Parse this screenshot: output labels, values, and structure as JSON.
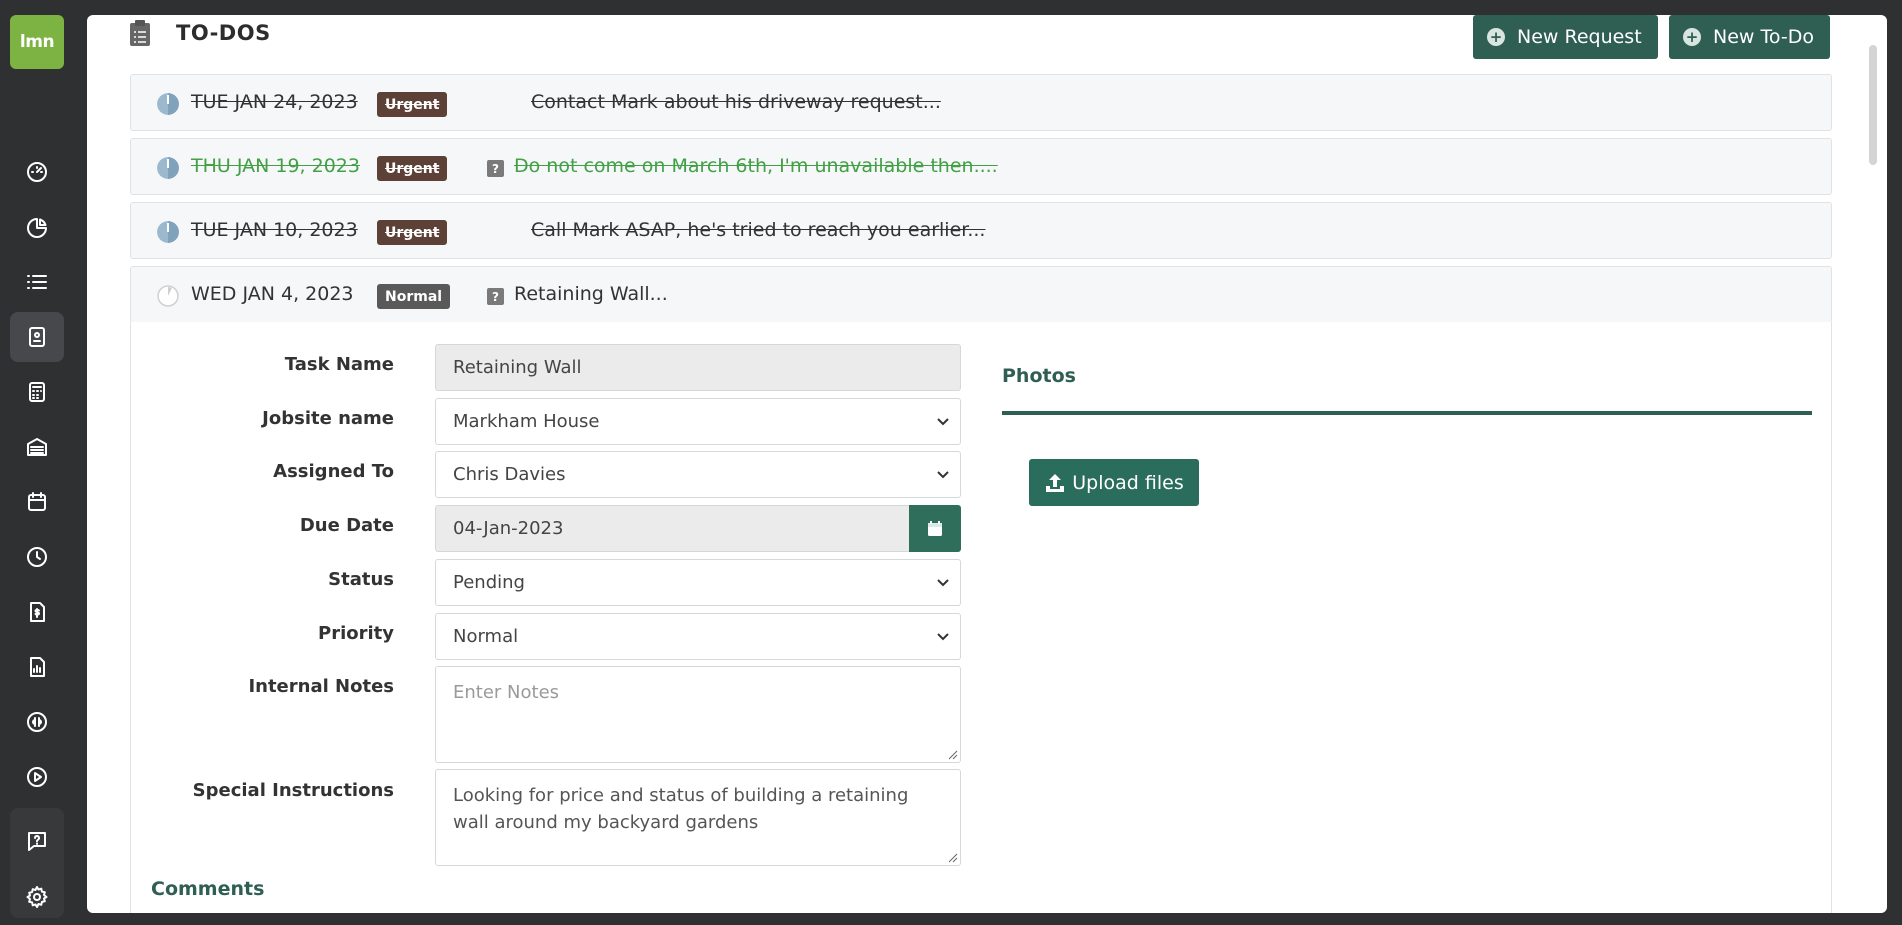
{
  "sidebar": {
    "logo": "lmn",
    "items": [
      {
        "name": "dashboard",
        "icon": "speedometer-icon"
      },
      {
        "name": "reports",
        "icon": "pie-chart-icon"
      },
      {
        "name": "list",
        "icon": "list-icon"
      },
      {
        "name": "contacts",
        "icon": "contact-card-icon",
        "active": true
      },
      {
        "name": "estimates",
        "icon": "calculator-icon"
      },
      {
        "name": "garage",
        "icon": "garage-icon"
      },
      {
        "name": "calendar",
        "icon": "calendar-icon"
      },
      {
        "name": "time",
        "icon": "clock-icon"
      },
      {
        "name": "invoices",
        "icon": "invoice-icon"
      },
      {
        "name": "analytics",
        "icon": "bar-report-icon"
      },
      {
        "name": "quickbooks",
        "icon": "quickbooks-icon"
      },
      {
        "name": "videos",
        "icon": "play-icon"
      },
      {
        "name": "help",
        "icon": "help-chat-icon"
      },
      {
        "name": "settings",
        "icon": "gear-icon"
      }
    ]
  },
  "header": {
    "title": "TO-DOS",
    "new_request": "New Request",
    "new_todo": "New To-Do"
  },
  "todos": [
    {
      "date": "TUE JAN 24, 2023",
      "priority": "Urgent",
      "text": "Contact Mark about his driveway request...",
      "completed": true,
      "has_question": false,
      "green": false
    },
    {
      "date": "THU JAN 19, 2023",
      "priority": "Urgent",
      "text": "Do not come on March 6th, I'm unavailable then....",
      "completed": true,
      "has_question": true,
      "green": true
    },
    {
      "date": "TUE JAN 10, 2023",
      "priority": "Urgent",
      "text": "Call Mark ASAP, he's tried to reach you earlier...",
      "completed": true,
      "has_question": false,
      "green": false
    },
    {
      "date": "WED JAN 4, 2023",
      "priority": "Normal",
      "text": "Retaining Wall...",
      "completed": false,
      "has_question": true,
      "green": false
    }
  ],
  "form": {
    "task_name_label": "Task Name",
    "task_name_value": "Retaining Wall",
    "jobsite_label": "Jobsite name",
    "jobsite_value": "Markham House",
    "assigned_label": "Assigned To",
    "assigned_value": "Chris Davies",
    "due_label": "Due Date",
    "due_value": "04-Jan-2023",
    "status_label": "Status",
    "status_value": "Pending",
    "priority_label": "Priority",
    "priority_value": "Normal",
    "notes_label": "Internal Notes",
    "notes_placeholder": "Enter Notes",
    "instructions_label": "Special Instructions",
    "instructions_value": "Looking for price and status of building a retaining wall around my backyard gardens"
  },
  "photos": {
    "title": "Photos",
    "upload": "Upload files"
  },
  "comments_title": "Comments",
  "colors": {
    "accent": "#2f5e52",
    "logo": "#7cb342",
    "urgent": "#5d4136",
    "normal": "#595959",
    "done_text": "#43a047"
  }
}
